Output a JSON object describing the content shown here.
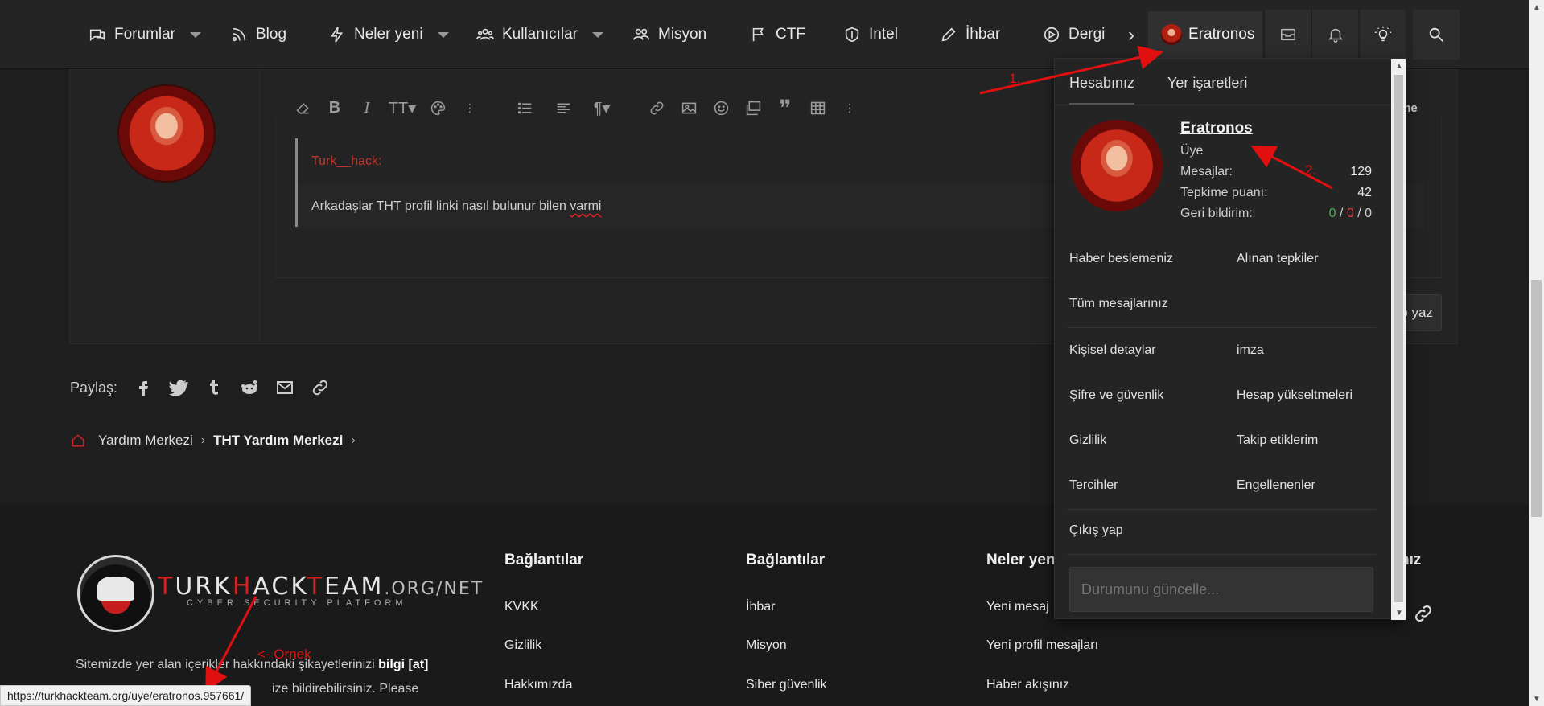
{
  "nav": {
    "items": [
      {
        "label": "Forumlar",
        "icon": "chat-icon",
        "caret": true
      },
      {
        "label": "Blog",
        "icon": "rss-icon",
        "caret": false
      },
      {
        "label": "Neler yeni",
        "icon": "bolt-icon",
        "caret": true
      },
      {
        "label": "Kullanıcılar",
        "icon": "users-icon",
        "caret": true
      },
      {
        "label": "Misyon",
        "icon": "group-icon",
        "caret": false
      },
      {
        "label": "CTF",
        "icon": "flag-icon",
        "caret": false
      },
      {
        "label": "Intel",
        "icon": "shield-icon",
        "caret": false
      },
      {
        "label": "İhbar",
        "icon": "pencil-icon",
        "caret": false
      },
      {
        "label": "Dergi",
        "icon": "compass-icon",
        "caret": false
      }
    ],
    "more": "›",
    "username": "Eratronos"
  },
  "editor": {
    "quote_author": "Turk__hack:",
    "quote_text_prefix": "Arkadaşlar THT profil linki nasıl bulunur bilen ",
    "quote_text_misspelled": "varmi",
    "partial_label": "me",
    "reply_partial": "b yaz"
  },
  "share": {
    "label": "Paylaş:"
  },
  "breadcrumb": {
    "items": [
      "Yardım Merkezi",
      "THT Yardım Merkezi"
    ]
  },
  "dropdown": {
    "tabs": [
      "Hesabınız",
      "Yer işaretleri"
    ],
    "name": "Eratronos",
    "role": "Üye",
    "stats": [
      {
        "label": "Mesajlar:",
        "value": "129"
      },
      {
        "label": "Tepkime puanı:",
        "value": "42"
      }
    ],
    "feedback": {
      "label": "Geri bildirim:",
      "positive": "0",
      "negative": "0",
      "neutral": "0",
      "sep": "/"
    },
    "links_group1": [
      "Haber beslemeniz",
      "Alınan tepkiler",
      "Tüm mesajlarınız"
    ],
    "links_group2": [
      "Kişisel detaylar",
      "imza",
      "Şifre ve güvenlik",
      "Hesap yükseltmeleri",
      "Gizlilik",
      "Takip etiklerim",
      "Tercihler",
      "Engellenenler"
    ],
    "logout": "Çıkış yap",
    "status_placeholder": "Durumunu güncelle..."
  },
  "footer": {
    "logo_t": "T",
    "logo_urk": "URK",
    "logo_h": "H",
    "logo_ack": "ACK",
    "logo_t2": "T",
    "logo_eam": "EAM",
    "logo_domain": ".ORG/NET",
    "logo_sub": "CYBER SECURITY PLATFORM",
    "about_prefix": "Sitemizde yer alan içerikler hakkındaki şikayetlerinizi ",
    "about_bold": "bilgi [at]",
    "about_line2": "ize bildirebilirsiniz. Please",
    "col1": {
      "title": "Bağlantılar",
      "links": [
        "KVKK",
        "Gizlilik",
        "Hakkımızda"
      ]
    },
    "col2": {
      "title": "Bağlantılar",
      "links": [
        "İhbar",
        "Misyon",
        "Siber güvenlik"
      ]
    },
    "col3": {
      "title": "Neler yen",
      "links": [
        "Yeni mesaj",
        "Yeni profil mesajları",
        "Haber akışınız"
      ]
    },
    "col4_title_fragment": "nız"
  },
  "annotations": {
    "one": "1.",
    "two": "2.",
    "example": "<- Ornek"
  },
  "status_url": "https://turkhackteam.org/uye/eratronos.957661/"
}
